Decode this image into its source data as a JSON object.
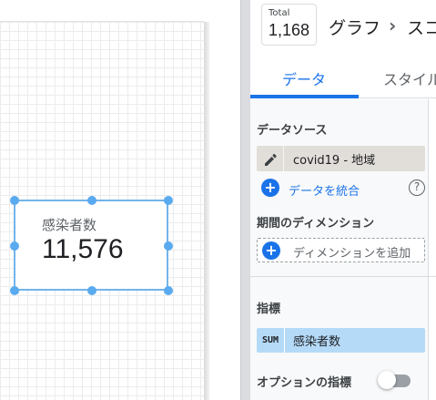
{
  "canvas": {
    "scorecard": {
      "label": "感染者数",
      "value": "11,576"
    }
  },
  "header": {
    "total_label": "Total",
    "total_value": "1,168",
    "breadcrumb": [
      "グラフ",
      "スコ"
    ],
    "separator": "›"
  },
  "tabs": [
    {
      "label": "データ",
      "active": true
    },
    {
      "label": "スタイル",
      "active": false
    }
  ],
  "data_panel": {
    "data_source_title": "データソース",
    "data_source_name": "covid19 - 地域",
    "blend_link": "データを統合",
    "help_icon": "?",
    "date_range_dimension_title": "期間のディメンション",
    "add_dimension": "ディメンションを追加",
    "metrics_title": "指標",
    "metric": {
      "aggregation": "SUM",
      "name": "感染者数"
    },
    "optional_metrics_title": "オプションの指標",
    "optional_metrics_enabled": false
  },
  "icons": {
    "edit": "pencil-icon",
    "add": "plus-circle-icon",
    "help": "help-circle-icon"
  },
  "colors": {
    "accent": "#1a73e8",
    "selection": "#74b4ea",
    "metric_chip": "#b4daf8",
    "data_source_chip": "#e1ddd9"
  }
}
